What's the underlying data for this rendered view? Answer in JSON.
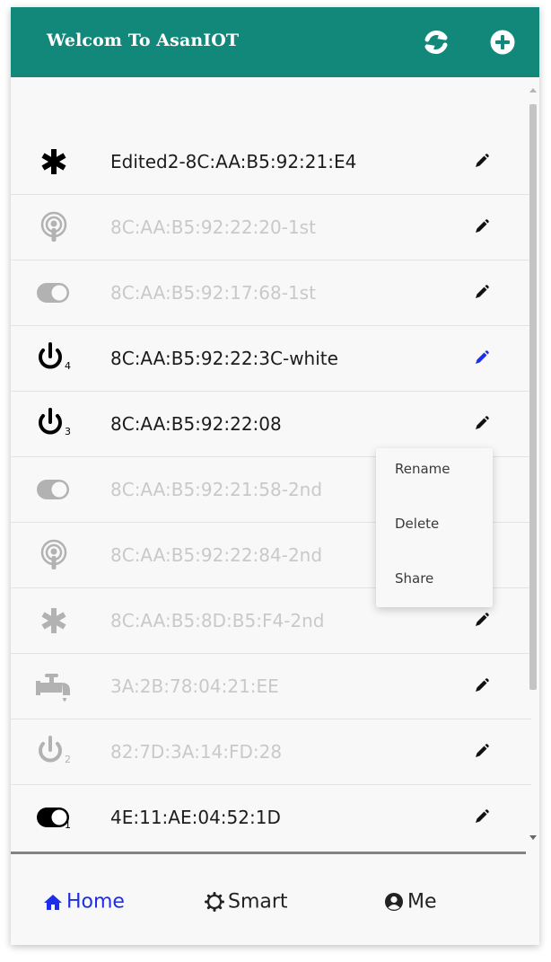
{
  "header": {
    "title": "Welcom To AsanIOT",
    "refresh_icon": "refresh-icon",
    "add_icon": "plus-circle-icon",
    "background_color": "#12887a"
  },
  "devices": [
    {
      "name": "Edited2-8C:AA:B5:92:21:E4",
      "icon": "asterisk-icon",
      "disabled": false
    },
    {
      "name": "8C:AA:B5:92:22:20-1st",
      "icon": "podcast-icon",
      "disabled": true
    },
    {
      "name": "8C:AA:B5:92:17:68-1st",
      "icon": "toggle-on-icon",
      "disabled": true
    },
    {
      "name": "8C:AA:B5:92:22:3C-white",
      "icon": "power-icon",
      "badge": "4",
      "disabled": false
    },
    {
      "name": "8C:AA:B5:92:22:08",
      "icon": "power-icon",
      "badge": "3",
      "disabled": false
    },
    {
      "name": "8C:AA:B5:92:21:58-2nd",
      "icon": "toggle-on-icon",
      "disabled": true
    },
    {
      "name": "8C:AA:B5:92:22:84-2nd",
      "icon": "podcast-icon",
      "disabled": true
    },
    {
      "name": "8C:AA:B5:8D:B5:F4-2nd",
      "icon": "asterisk-icon",
      "disabled": true
    },
    {
      "name": "3A:2B:78:04:21:EE",
      "icon": "faucet-icon",
      "disabled": true
    },
    {
      "name": "82:7D:3A:14:FD:28",
      "icon": "power-icon",
      "badge": "2",
      "disabled": true
    },
    {
      "name": "4E:11:AE:04:52:1D",
      "icon": "toggle-on-icon",
      "badge": "1",
      "disabled": false
    }
  ],
  "context_menu": {
    "items": [
      "Rename",
      "Delete",
      "Share"
    ]
  },
  "bottom_nav": {
    "home": "Home",
    "smart": "Smart",
    "me": "Me",
    "active_color": "#1d2ee6"
  }
}
